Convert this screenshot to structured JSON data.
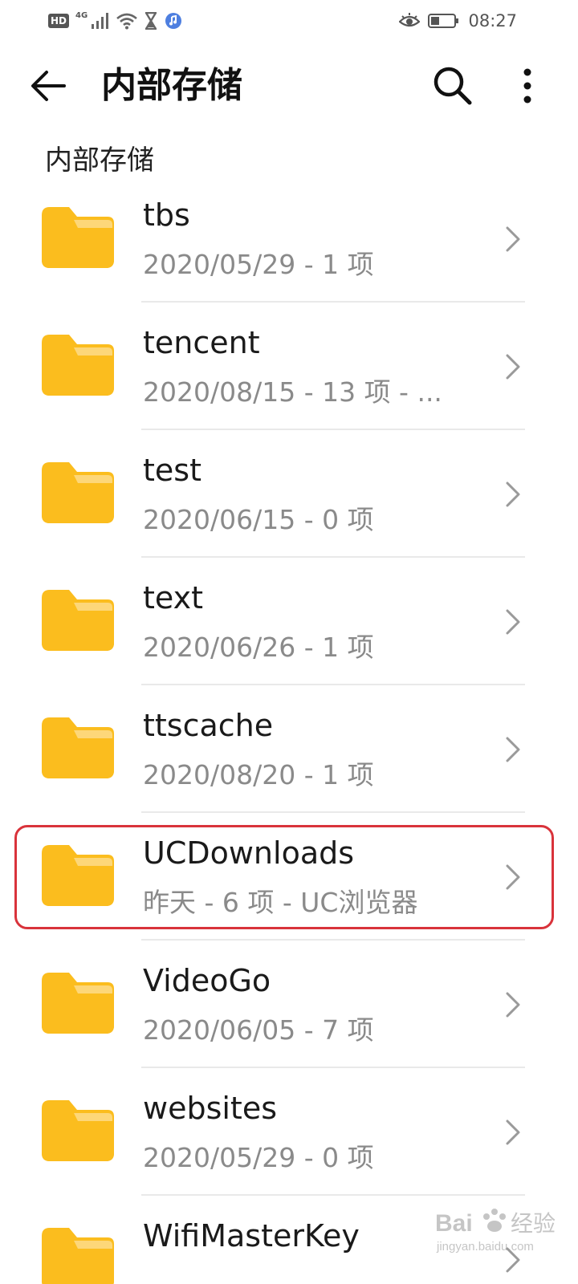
{
  "status_bar": {
    "hd_label": "HD",
    "network_label": "4G",
    "time": "08:27",
    "icons": [
      "signal-icon",
      "wifi-icon",
      "hourglass-icon",
      "music-app-icon",
      "eye-icon",
      "battery-icon"
    ]
  },
  "app_bar": {
    "title": "内部存储",
    "icons": [
      "back-arrow-icon",
      "search-icon",
      "more-vert-icon"
    ]
  },
  "breadcrumb": "内部存储",
  "files": [
    {
      "name": "tbs",
      "meta": "2020/05/29 - 1 项"
    },
    {
      "name": "tencent",
      "meta": "2020/08/15 - 13 项 - ..."
    },
    {
      "name": "test",
      "meta": "2020/06/15 - 0 项"
    },
    {
      "name": "text",
      "meta": "2020/06/26 - 1 项"
    },
    {
      "name": "ttscache",
      "meta": "2020/08/20 - 1 项"
    },
    {
      "name": "UCDownloads",
      "meta": "昨天 - 6 项 - UC浏览器"
    },
    {
      "name": "VideoGo",
      "meta": "2020/06/05 - 7 项"
    },
    {
      "name": "websites",
      "meta": "2020/05/29 - 0 项"
    },
    {
      "name": "WifiMasterKey",
      "meta": ""
    }
  ],
  "highlighted_file": "UCDownloads",
  "colors": {
    "folder_main": "#fbbd1e",
    "folder_tab": "#fdd779",
    "highlight": "#d9333b",
    "meta_text": "#8a8a8a"
  },
  "watermark": {
    "text": "Bai 经验",
    "url_text": "jingyan.baidu.com"
  }
}
